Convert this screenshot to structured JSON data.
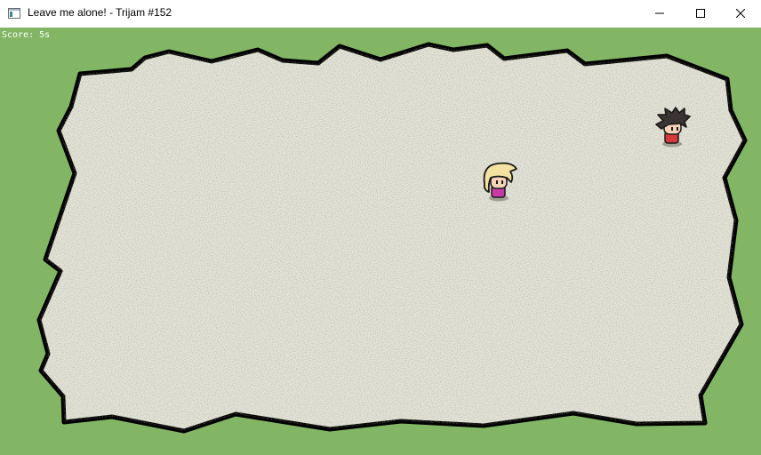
{
  "window": {
    "title": "Leave me alone! - Trijam #152"
  },
  "hud": {
    "score_text": "Score: 5s"
  },
  "icons": {
    "app": "app-window-icon",
    "minimize": "minimize-icon",
    "maximize": "maximize-icon",
    "close": "close-icon"
  },
  "colors": {
    "grass": "#82b664",
    "arena_floor": "#e4e4d8",
    "arena_border": "#000000",
    "player_hair": "#f3e2a0",
    "player_shirt": "#c83aa8",
    "chaser_hair": "#3a3434",
    "chaser_shirt": "#d43a3a"
  },
  "characters": {
    "player": "player-blonde-girl",
    "chaser": "chaser-spiky-hair-boy"
  }
}
